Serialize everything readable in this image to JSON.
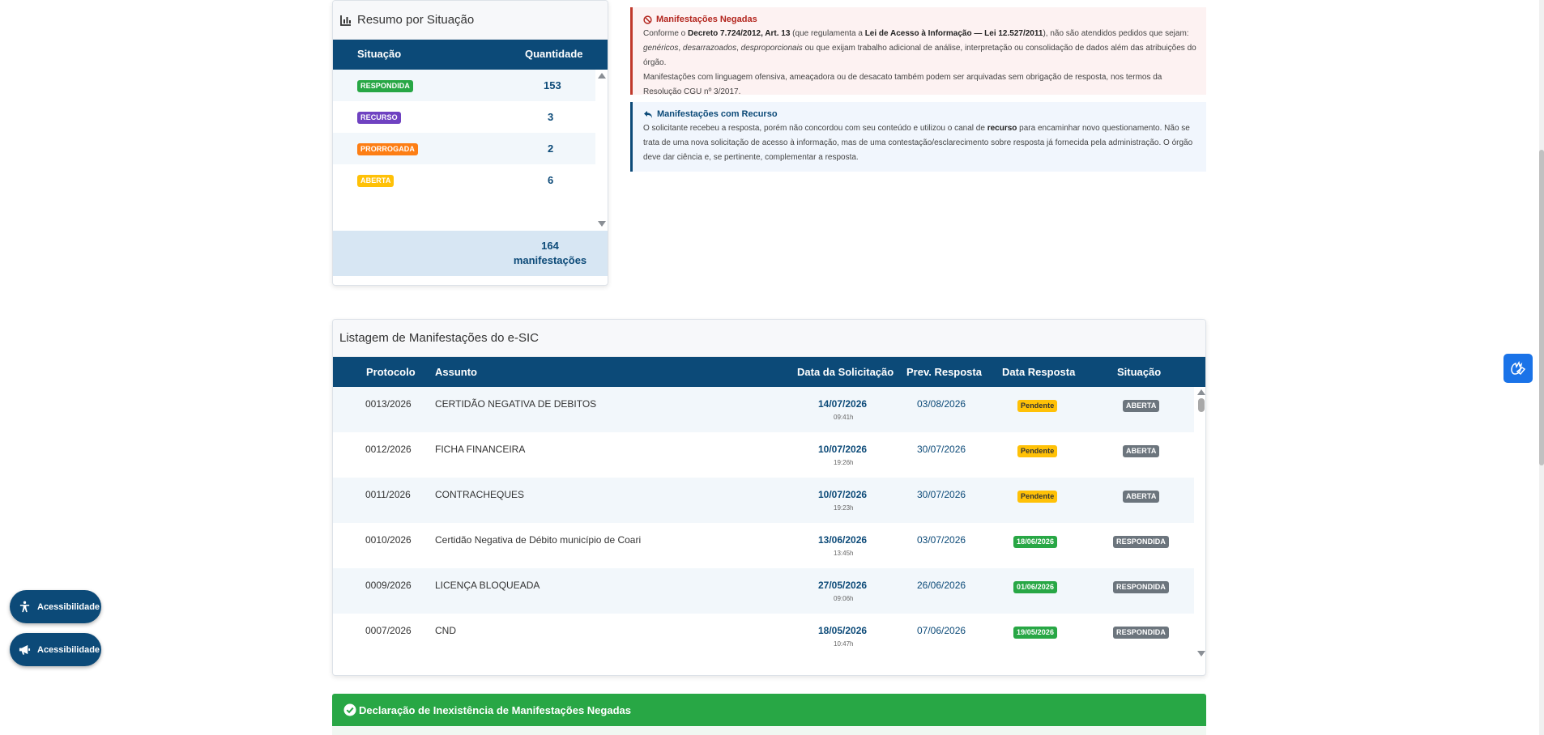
{
  "summary": {
    "title": "Resumo por Situação",
    "col_situacao": "Situação",
    "col_quantidade": "Quantidade",
    "rows": [
      {
        "label": "RESPONDIDA",
        "qty": "153",
        "color": "#28a745"
      },
      {
        "label": "RECURSO",
        "qty": "3",
        "color": "#6f42c1"
      },
      {
        "label": "PRORROGADA",
        "qty": "2",
        "color": "#fd7e14"
      },
      {
        "label": "ABERTA",
        "qty": "6",
        "color": "#ffc107"
      }
    ],
    "total_count": "164",
    "total_label": "manifestações"
  },
  "info_denied": {
    "title": "Manifestações Negadas",
    "t1": "Conforme o ",
    "b1": "Decreto 7.724/2012, Art. 13",
    "t2": " (que regulamenta a ",
    "b2": "Lei de Acesso à Informação — Lei 12.527/2011",
    "t3": "), não são atendidos pedidos que sejam: ",
    "i1": "genéricos",
    "t4": ", ",
    "i2": "desarrazoados",
    "t5": ", ",
    "i3": "desproporcionais",
    "t6": " ou que exijam trabalho adicional de análise, interpretação ou consolidação de dados além das atribuições do órgão.",
    "p2": "Manifestações com linguagem ofensiva, ameaçadora ou de desacato também podem ser arquivadas sem obrigação de resposta, nos termos da Resolução CGU nº 3/2017."
  },
  "info_recurso": {
    "title": "Manifestações com Recurso",
    "t1": "O solicitante recebeu a resposta, porém não concordou com seu conteúdo e utilizou o canal de ",
    "b1": "recurso",
    "t2": " para encaminhar novo questionamento. Não se trata de uma nova solicitação de acesso à informação, mas de uma contestação/esclarecimento sobre resposta já fornecida pela administração. O órgão deve dar ciência e, se pertinente, complementar a resposta."
  },
  "listing": {
    "title": "Listagem de Manifestações do e-SIC",
    "headers": {
      "protocolo": "Protocolo",
      "assunto": "Assunto",
      "data_solicitacao": "Data da Solicitação",
      "prev_resposta": "Prev. Resposta",
      "data_resposta": "Data Resposta",
      "situacao": "Situação"
    },
    "rows": [
      {
        "protocolo": "0013/2026",
        "assunto": "CERTIDÃO NEGATIVA DE DEBITOS",
        "data": "14/07/2026",
        "hora": "09:41h",
        "prev": "03/08/2026",
        "resposta": "Pendente",
        "resposta_color": "#ffc107",
        "situacao": "ABERTA"
      },
      {
        "protocolo": "0012/2026",
        "assunto": "FICHA FINANCEIRA",
        "data": "10/07/2026",
        "hora": "19:26h",
        "prev": "30/07/2026",
        "resposta": "Pendente",
        "resposta_color": "#ffc107",
        "situacao": "ABERTA"
      },
      {
        "protocolo": "0011/2026",
        "assunto": "CONTRACHEQUES",
        "data": "10/07/2026",
        "hora": "19:23h",
        "prev": "30/07/2026",
        "resposta": "Pendente",
        "resposta_color": "#ffc107",
        "situacao": "ABERTA"
      },
      {
        "protocolo": "0010/2026",
        "assunto": "Certidão Negativa de Débito município de Coari",
        "data": "13/06/2026",
        "hora": "13:45h",
        "prev": "03/07/2026",
        "resposta": "18/06/2026",
        "resposta_color": "#28a745",
        "situacao": "RESPONDIDA"
      },
      {
        "protocolo": "0009/2026",
        "assunto": "LICENÇA BLOQUEADA",
        "data": "27/05/2026",
        "hora": "09:06h",
        "prev": "26/06/2026",
        "resposta": "01/06/2026",
        "resposta_color": "#28a745",
        "situacao": "RESPONDIDA"
      },
      {
        "protocolo": "0007/2026",
        "assunto": "CND",
        "data": "18/05/2026",
        "hora": "10:47h",
        "prev": "07/06/2026",
        "resposta": "19/05/2026",
        "resposta_color": "#28a745",
        "situacao": "RESPONDIDA"
      }
    ],
    "situacao_badge_color": "#6c757d"
  },
  "declaration": {
    "title": "Declaração de Inexistência de Manifestações Negadas"
  },
  "accessibility": {
    "button1": "Acessibilidade",
    "button2": "Acessibilidade"
  },
  "icons": {
    "summary": "chart-bar-icon",
    "denied": "ban-icon",
    "recurso": "reply-icon",
    "declaration": "check-circle-icon",
    "acc1": "universal-access-icon",
    "acc2": "bullhorn-icon",
    "vlibras": "sign-language-hands-icon"
  }
}
